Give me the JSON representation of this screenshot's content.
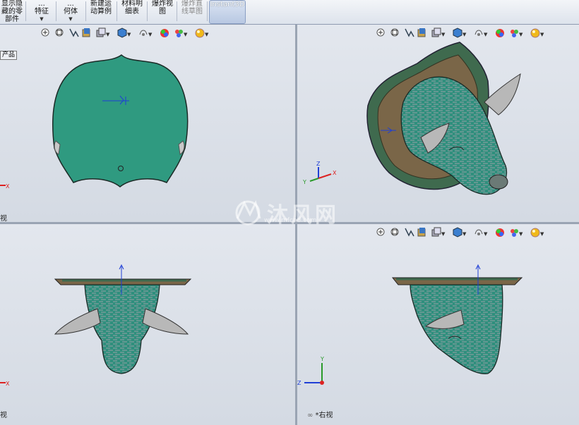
{
  "ribbon": {
    "buttons": [
      {
        "label": "显示隐\n藏的零\n部件",
        "dim": false,
        "caret": false
      },
      {
        "label": "...\n特征",
        "dim": false,
        "caret": true
      },
      {
        "label": "...\n何体",
        "dim": false,
        "caret": true
      },
      {
        "label": "新建运\n动算例",
        "dim": false,
        "caret": false
      },
      {
        "label": "材料明\n细表",
        "dim": false,
        "caret": false
      },
      {
        "label": "爆炸视\n图",
        "dim": false,
        "caret": false
      },
      {
        "label": "爆炸直\n线草图",
        "dim": true,
        "caret": false
      },
      {
        "label": "Instant3D",
        "dim": false,
        "caret": false
      }
    ]
  },
  "feature_tab": "产品",
  "viewports": {
    "top_left": {
      "label": "视"
    },
    "top_right": {
      "label": ""
    },
    "bottom_left": {
      "label": "视"
    },
    "bottom_right": {
      "label": "*右视"
    }
  },
  "triad_labels": {
    "x": "X",
    "y": "Y",
    "z": "Z"
  },
  "watermark": {
    "text": "沐风网",
    "url": "www.mfcad.com"
  },
  "colors": {
    "model_teal": "#2f8f7d",
    "model_gray": "#9aa0a8",
    "plaque_brown": "#7a6648",
    "plaque_green": "#3f6a4e",
    "background": "#d8dde6"
  },
  "view_toolbar_icons": [
    "zoom-to-fit-icon",
    "zoom-area-icon",
    "previous-view-icon",
    "section-view-icon",
    "view-orientation-icon",
    "display-style-icon",
    "hide-show-items-icon",
    "edit-appearance-icon",
    "apply-scene-icon",
    "view-settings-icon"
  ]
}
